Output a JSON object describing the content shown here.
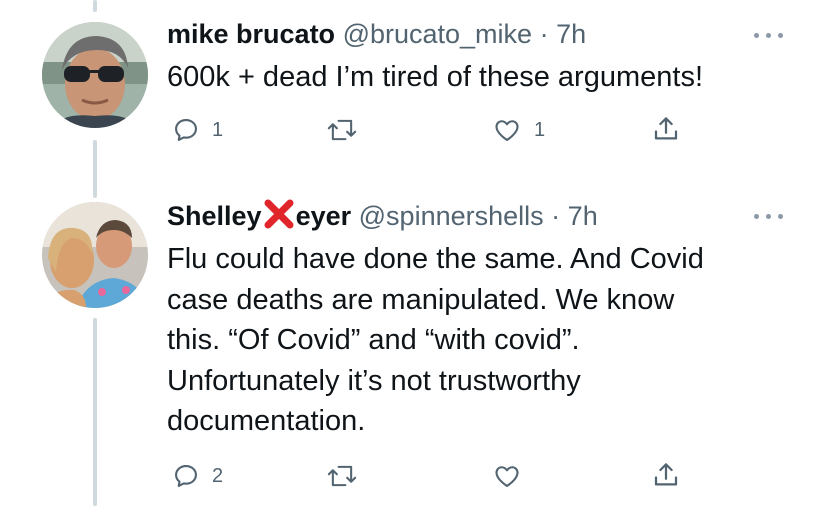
{
  "tweets": [
    {
      "display_name": "mike brucato",
      "handle": "@brucato_mike",
      "separator": "·",
      "time": "7h",
      "text": "600k + dead I’m tired of these arguments!",
      "actions": {
        "replies": "1",
        "retweets": "",
        "likes": "1"
      }
    },
    {
      "display_name_start": "Shelley",
      "display_name_emoji": "cross-mark-icon",
      "display_name_end": "eyer",
      "handle": "@spinnershells",
      "separator": "·",
      "time": "7h",
      "text_lines": [
        "Flu could have done the same. And Covid",
        "case deaths are manipulated. We know",
        "this. “Of Covid” and “with covid”.",
        "Unfortunately it’s not trustworthy",
        "documentation."
      ],
      "actions": {
        "replies": "2",
        "retweets": "",
        "likes": ""
      }
    }
  ],
  "colors": {
    "text": "#0f1419",
    "secondary": "#536471",
    "thread_line": "#cfd9de",
    "cross_mark": "#e0262b"
  }
}
